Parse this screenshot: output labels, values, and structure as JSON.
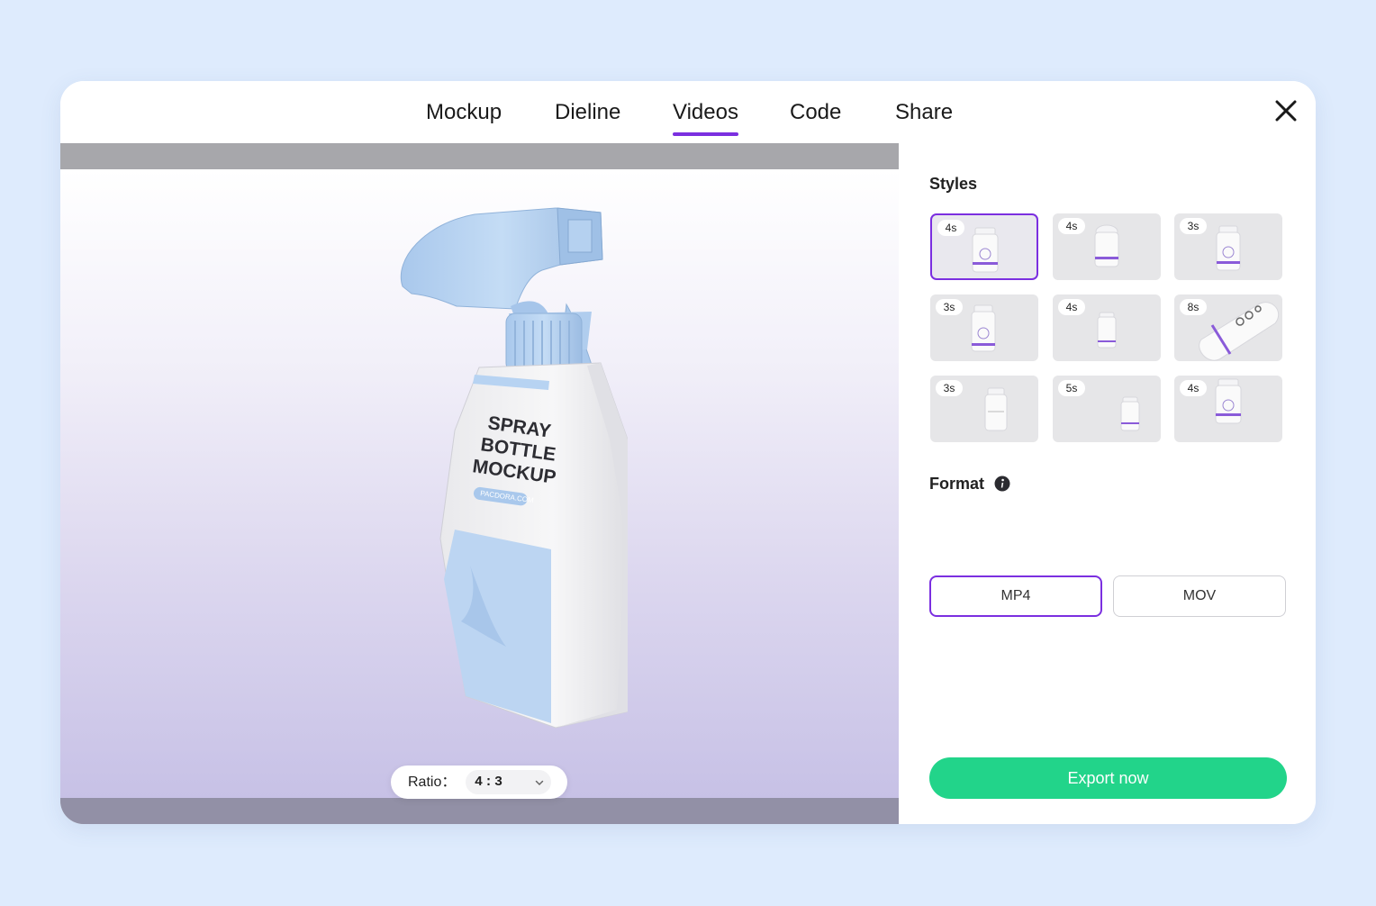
{
  "tabs": [
    {
      "label": "Mockup"
    },
    {
      "label": "Dieline"
    },
    {
      "label": "Videos"
    },
    {
      "label": "Code"
    },
    {
      "label": "Share"
    }
  ],
  "active_tab": "Videos",
  "preview": {
    "product_text": [
      "SPRAY",
      "BOTTLE",
      "MOCKUP"
    ],
    "website": "PACDORA.COM",
    "ratio_label": "Ratio：",
    "ratio_value": "4:3"
  },
  "styles": {
    "title": "Styles",
    "items": [
      {
        "duration": "4s",
        "selected": true
      },
      {
        "duration": "4s",
        "selected": false
      },
      {
        "duration": "3s",
        "selected": false
      },
      {
        "duration": "3s",
        "selected": false
      },
      {
        "duration": "4s",
        "selected": false
      },
      {
        "duration": "8s",
        "selected": false
      },
      {
        "duration": "3s",
        "selected": false
      },
      {
        "duration": "5s",
        "selected": false
      },
      {
        "duration": "4s",
        "selected": false
      }
    ]
  },
  "format": {
    "title": "Format",
    "options": [
      {
        "label": "MP4",
        "selected": true
      },
      {
        "label": "MOV",
        "selected": false
      }
    ]
  },
  "export_label": "Export now",
  "colors": {
    "accent": "#7b2fe0",
    "export": "#22d48a",
    "background": "#deebfd",
    "bottle_cap": "#b7d3f2"
  }
}
